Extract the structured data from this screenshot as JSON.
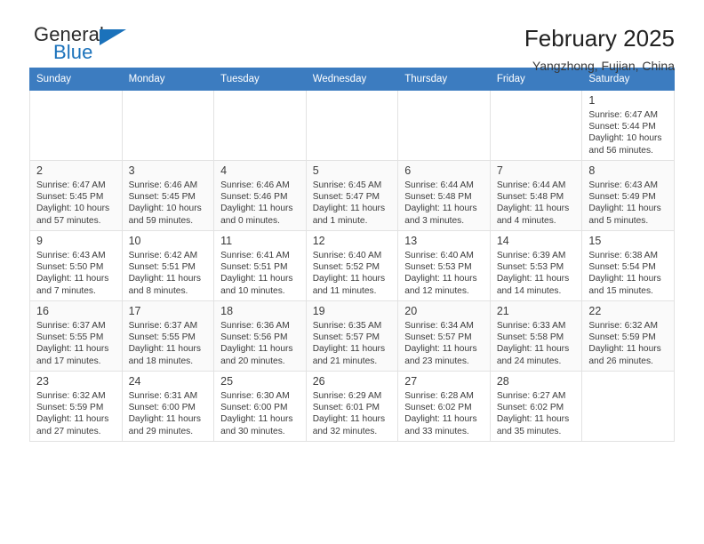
{
  "brand": {
    "name_top": "General",
    "name_bottom": "Blue",
    "accent_color": "#1b72bb"
  },
  "header": {
    "title": "February 2025",
    "subtitle": "Yangzhong, Fujian, China"
  },
  "calendar": {
    "header_background": "#3c7cc0",
    "weekdays": [
      "Sunday",
      "Monday",
      "Tuesday",
      "Wednesday",
      "Thursday",
      "Friday",
      "Saturday"
    ],
    "weeks": [
      [
        {
          "day": "",
          "detail": ""
        },
        {
          "day": "",
          "detail": ""
        },
        {
          "day": "",
          "detail": ""
        },
        {
          "day": "",
          "detail": ""
        },
        {
          "day": "",
          "detail": ""
        },
        {
          "day": "",
          "detail": ""
        },
        {
          "day": "1",
          "detail": "Sunrise: 6:47 AM\nSunset: 5:44 PM\nDaylight: 10 hours and 56 minutes."
        }
      ],
      [
        {
          "day": "2",
          "detail": "Sunrise: 6:47 AM\nSunset: 5:45 PM\nDaylight: 10 hours and 57 minutes."
        },
        {
          "day": "3",
          "detail": "Sunrise: 6:46 AM\nSunset: 5:45 PM\nDaylight: 10 hours and 59 minutes."
        },
        {
          "day": "4",
          "detail": "Sunrise: 6:46 AM\nSunset: 5:46 PM\nDaylight: 11 hours and 0 minutes."
        },
        {
          "day": "5",
          "detail": "Sunrise: 6:45 AM\nSunset: 5:47 PM\nDaylight: 11 hours and 1 minute."
        },
        {
          "day": "6",
          "detail": "Sunrise: 6:44 AM\nSunset: 5:48 PM\nDaylight: 11 hours and 3 minutes."
        },
        {
          "day": "7",
          "detail": "Sunrise: 6:44 AM\nSunset: 5:48 PM\nDaylight: 11 hours and 4 minutes."
        },
        {
          "day": "8",
          "detail": "Sunrise: 6:43 AM\nSunset: 5:49 PM\nDaylight: 11 hours and 5 minutes."
        }
      ],
      [
        {
          "day": "9",
          "detail": "Sunrise: 6:43 AM\nSunset: 5:50 PM\nDaylight: 11 hours and 7 minutes."
        },
        {
          "day": "10",
          "detail": "Sunrise: 6:42 AM\nSunset: 5:51 PM\nDaylight: 11 hours and 8 minutes."
        },
        {
          "day": "11",
          "detail": "Sunrise: 6:41 AM\nSunset: 5:51 PM\nDaylight: 11 hours and 10 minutes."
        },
        {
          "day": "12",
          "detail": "Sunrise: 6:40 AM\nSunset: 5:52 PM\nDaylight: 11 hours and 11 minutes."
        },
        {
          "day": "13",
          "detail": "Sunrise: 6:40 AM\nSunset: 5:53 PM\nDaylight: 11 hours and 12 minutes."
        },
        {
          "day": "14",
          "detail": "Sunrise: 6:39 AM\nSunset: 5:53 PM\nDaylight: 11 hours and 14 minutes."
        },
        {
          "day": "15",
          "detail": "Sunrise: 6:38 AM\nSunset: 5:54 PM\nDaylight: 11 hours and 15 minutes."
        }
      ],
      [
        {
          "day": "16",
          "detail": "Sunrise: 6:37 AM\nSunset: 5:55 PM\nDaylight: 11 hours and 17 minutes."
        },
        {
          "day": "17",
          "detail": "Sunrise: 6:37 AM\nSunset: 5:55 PM\nDaylight: 11 hours and 18 minutes."
        },
        {
          "day": "18",
          "detail": "Sunrise: 6:36 AM\nSunset: 5:56 PM\nDaylight: 11 hours and 20 minutes."
        },
        {
          "day": "19",
          "detail": "Sunrise: 6:35 AM\nSunset: 5:57 PM\nDaylight: 11 hours and 21 minutes."
        },
        {
          "day": "20",
          "detail": "Sunrise: 6:34 AM\nSunset: 5:57 PM\nDaylight: 11 hours and 23 minutes."
        },
        {
          "day": "21",
          "detail": "Sunrise: 6:33 AM\nSunset: 5:58 PM\nDaylight: 11 hours and 24 minutes."
        },
        {
          "day": "22",
          "detail": "Sunrise: 6:32 AM\nSunset: 5:59 PM\nDaylight: 11 hours and 26 minutes."
        }
      ],
      [
        {
          "day": "23",
          "detail": "Sunrise: 6:32 AM\nSunset: 5:59 PM\nDaylight: 11 hours and 27 minutes."
        },
        {
          "day": "24",
          "detail": "Sunrise: 6:31 AM\nSunset: 6:00 PM\nDaylight: 11 hours and 29 minutes."
        },
        {
          "day": "25",
          "detail": "Sunrise: 6:30 AM\nSunset: 6:00 PM\nDaylight: 11 hours and 30 minutes."
        },
        {
          "day": "26",
          "detail": "Sunrise: 6:29 AM\nSunset: 6:01 PM\nDaylight: 11 hours and 32 minutes."
        },
        {
          "day": "27",
          "detail": "Sunrise: 6:28 AM\nSunset: 6:02 PM\nDaylight: 11 hours and 33 minutes."
        },
        {
          "day": "28",
          "detail": "Sunrise: 6:27 AM\nSunset: 6:02 PM\nDaylight: 11 hours and 35 minutes."
        },
        {
          "day": "",
          "detail": ""
        }
      ]
    ]
  }
}
